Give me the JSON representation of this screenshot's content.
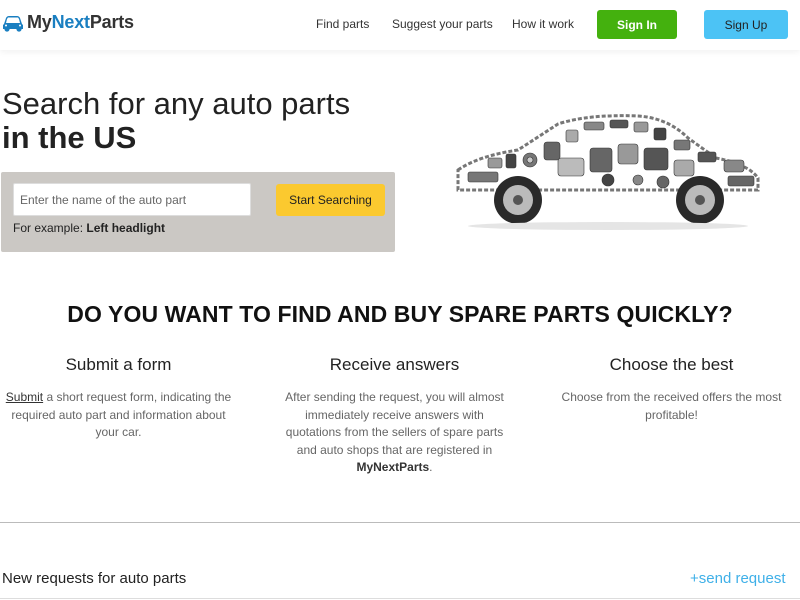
{
  "header": {
    "logo": {
      "part1": "My",
      "part2": "Next",
      "part3": "Parts"
    },
    "nav": [
      "Find parts",
      "Suggest your parts",
      "How it work"
    ],
    "signin_label": "Sign In",
    "signup_label": "Sign Up"
  },
  "hero": {
    "title_line1": "Search for any auto parts",
    "title_line2": "in the US",
    "search": {
      "placeholder": "Enter the name of the auto part",
      "button_label": "Start Searching",
      "example_prefix": "For example:",
      "example_value": "Left headlight"
    }
  },
  "section": {
    "title": "DO YOU WANT TO FIND AND BUY SPARE PARTS QUICKLY?",
    "columns": [
      {
        "title": "Submit a form",
        "link_text": "Submit",
        "text": "a short request form, indicating the required auto part and information about your car."
      },
      {
        "title": "Receive answers",
        "text": "After sending the request, you will almost immediately receive answers with quotations from the sellers of spare parts and auto shops that are registered in",
        "brand": "MyNextParts",
        "suffix": "."
      },
      {
        "title": "Choose the best",
        "text": "Choose from the received offers the most profitable!"
      }
    ]
  },
  "requests": {
    "title": "New requests for auto parts",
    "send_label": "+send request"
  },
  "colors": {
    "brand_blue": "#1a7fc1",
    "signin_green": "#44b10e",
    "signup_blue": "#4cc3f5",
    "search_yellow": "#fbc92f",
    "link_blue": "#3fb0e8"
  }
}
